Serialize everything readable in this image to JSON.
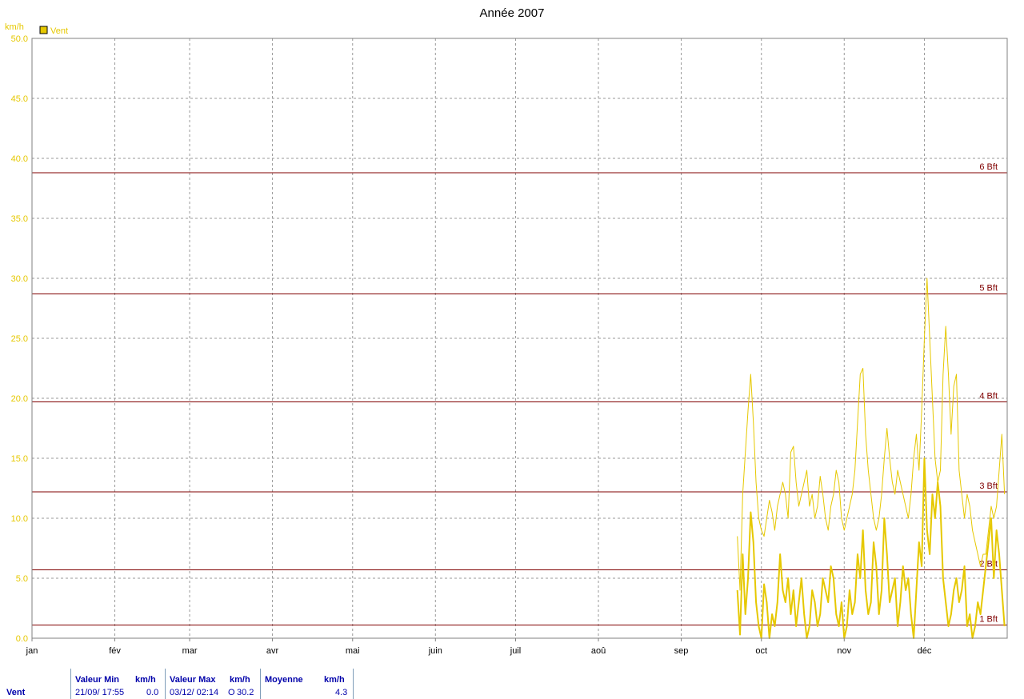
{
  "chart_data": {
    "type": "line",
    "title": "Année 2007",
    "ylabel": "km/h",
    "xlabel": "",
    "ylim": [
      0,
      50
    ],
    "yticks": [
      "0.0",
      "5.0",
      "10.0",
      "15.0",
      "20.0",
      "25.0",
      "30.0",
      "35.0",
      "40.0",
      "45.0",
      "50.0"
    ],
    "x_months": [
      "jan",
      "fév",
      "mar",
      "avr",
      "mai",
      "juin",
      "juil",
      "aoû",
      "sep",
      "oct",
      "nov",
      "déc"
    ],
    "grid": true,
    "legend": {
      "label": "Vent",
      "position": "top-left",
      "color": "#e6c800"
    },
    "line_color": "#e6c800",
    "threshold_color": "#800000",
    "thresholds": [
      {
        "label": "1 Bft",
        "value": 1.1
      },
      {
        "label": "2 Bft",
        "value": 5.7
      },
      {
        "label": "3 Bft",
        "value": 12.2
      },
      {
        "label": "4 Bft",
        "value": 19.7
      },
      {
        "label": "5 Bft",
        "value": 28.7
      },
      {
        "label": "6 Bft",
        "value": 38.8
      }
    ],
    "series": [
      {
        "style": "gusts",
        "x_day": [
          264,
          265,
          266,
          267,
          268,
          269,
          270,
          271,
          272,
          273,
          274,
          275,
          276,
          277,
          278,
          279,
          280,
          281,
          282,
          283,
          284,
          285,
          286,
          287,
          288,
          289,
          290,
          291,
          292,
          293,
          294,
          295,
          296,
          297,
          298,
          299,
          300,
          301,
          302,
          303,
          304,
          305,
          306,
          307,
          308,
          309,
          310,
          311,
          312,
          313,
          314,
          315,
          316,
          317,
          318,
          319,
          320,
          321,
          322,
          323,
          324,
          325,
          326,
          327,
          328,
          329,
          330,
          331,
          332,
          333,
          334,
          335,
          336,
          337,
          338,
          339,
          340,
          341,
          342,
          343,
          344,
          345,
          346,
          347,
          348,
          349,
          350,
          351,
          352,
          353,
          354,
          355,
          356,
          357,
          358,
          359,
          360,
          361,
          362,
          363,
          364
        ],
        "y": [
          8.5,
          4,
          12,
          15.5,
          19,
          22,
          18,
          13,
          10,
          9,
          8.5,
          10,
          11.5,
          10.5,
          9,
          11,
          12,
          13,
          12,
          10,
          15.5,
          16,
          13,
          11,
          12,
          13,
          14,
          11,
          12,
          10,
          11,
          13.5,
          12,
          10,
          9,
          11,
          12,
          14,
          13,
          10,
          9,
          10,
          11,
          12,
          14,
          18,
          22,
          22.5,
          17,
          14,
          12,
          10,
          9,
          10,
          12,
          15,
          17.5,
          15,
          13,
          12,
          14,
          13,
          12,
          11,
          10,
          12,
          15,
          17,
          14,
          19,
          25,
          30,
          25,
          20,
          15,
          13,
          14,
          22,
          26,
          22,
          17,
          21,
          22,
          14,
          12,
          10,
          12,
          11,
          9,
          8,
          7,
          6,
          7,
          7,
          9,
          11,
          10,
          11,
          14,
          17,
          12
        ]
      },
      {
        "style": "average",
        "x_day": [
          264,
          265,
          266,
          267,
          268,
          269,
          270,
          271,
          272,
          273,
          274,
          275,
          276,
          277,
          278,
          279,
          280,
          281,
          282,
          283,
          284,
          285,
          286,
          287,
          288,
          289,
          290,
          291,
          292,
          293,
          294,
          295,
          296,
          297,
          298,
          299,
          300,
          301,
          302,
          303,
          304,
          305,
          306,
          307,
          308,
          309,
          310,
          311,
          312,
          313,
          314,
          315,
          316,
          317,
          318,
          319,
          320,
          321,
          322,
          323,
          324,
          325,
          326,
          327,
          328,
          329,
          330,
          331,
          332,
          333,
          334,
          335,
          336,
          337,
          338,
          339,
          340,
          341,
          342,
          343,
          344,
          345,
          346,
          347,
          348,
          349,
          350,
          351,
          352,
          353,
          354,
          355,
          356,
          357,
          358,
          359,
          360,
          361,
          362,
          363,
          364
        ],
        "y": [
          4,
          0.3,
          7,
          2,
          5,
          10.5,
          8,
          3,
          1,
          0,
          4.5,
          3,
          0,
          2,
          1,
          3,
          7,
          4,
          3,
          5,
          2,
          4,
          1,
          3,
          5,
          2,
          0,
          1,
          4,
          3,
          1,
          2,
          5,
          4,
          3,
          6,
          5,
          2,
          1,
          3,
          0,
          1,
          4,
          2,
          3,
          7,
          5,
          9,
          4,
          2,
          3,
          8,
          6,
          2,
          4,
          10,
          7,
          3,
          4,
          5,
          1,
          3,
          6,
          4,
          5,
          2,
          0,
          4,
          8,
          6,
          15,
          9,
          7,
          12,
          10,
          13,
          11,
          5,
          3,
          1,
          2,
          4,
          5,
          3,
          4,
          6,
          1,
          2,
          0,
          1,
          3,
          2,
          4,
          6,
          8,
          10,
          5,
          9,
          7,
          4,
          1
        ]
      }
    ]
  },
  "stats": {
    "row_label": "Vent",
    "min_label": "Valeur Min",
    "min_unit": "km/h",
    "min_time": "21/09/  17:55",
    "min_value": "0.0",
    "max_label": "Valeur Max",
    "max_unit": "km/h",
    "max_time": "03/12/  02:14",
    "max_dir": "O",
    "max_value": "30.2",
    "avg_label": "Moyenne",
    "avg_unit": "km/h",
    "avg_value": "4.3"
  }
}
